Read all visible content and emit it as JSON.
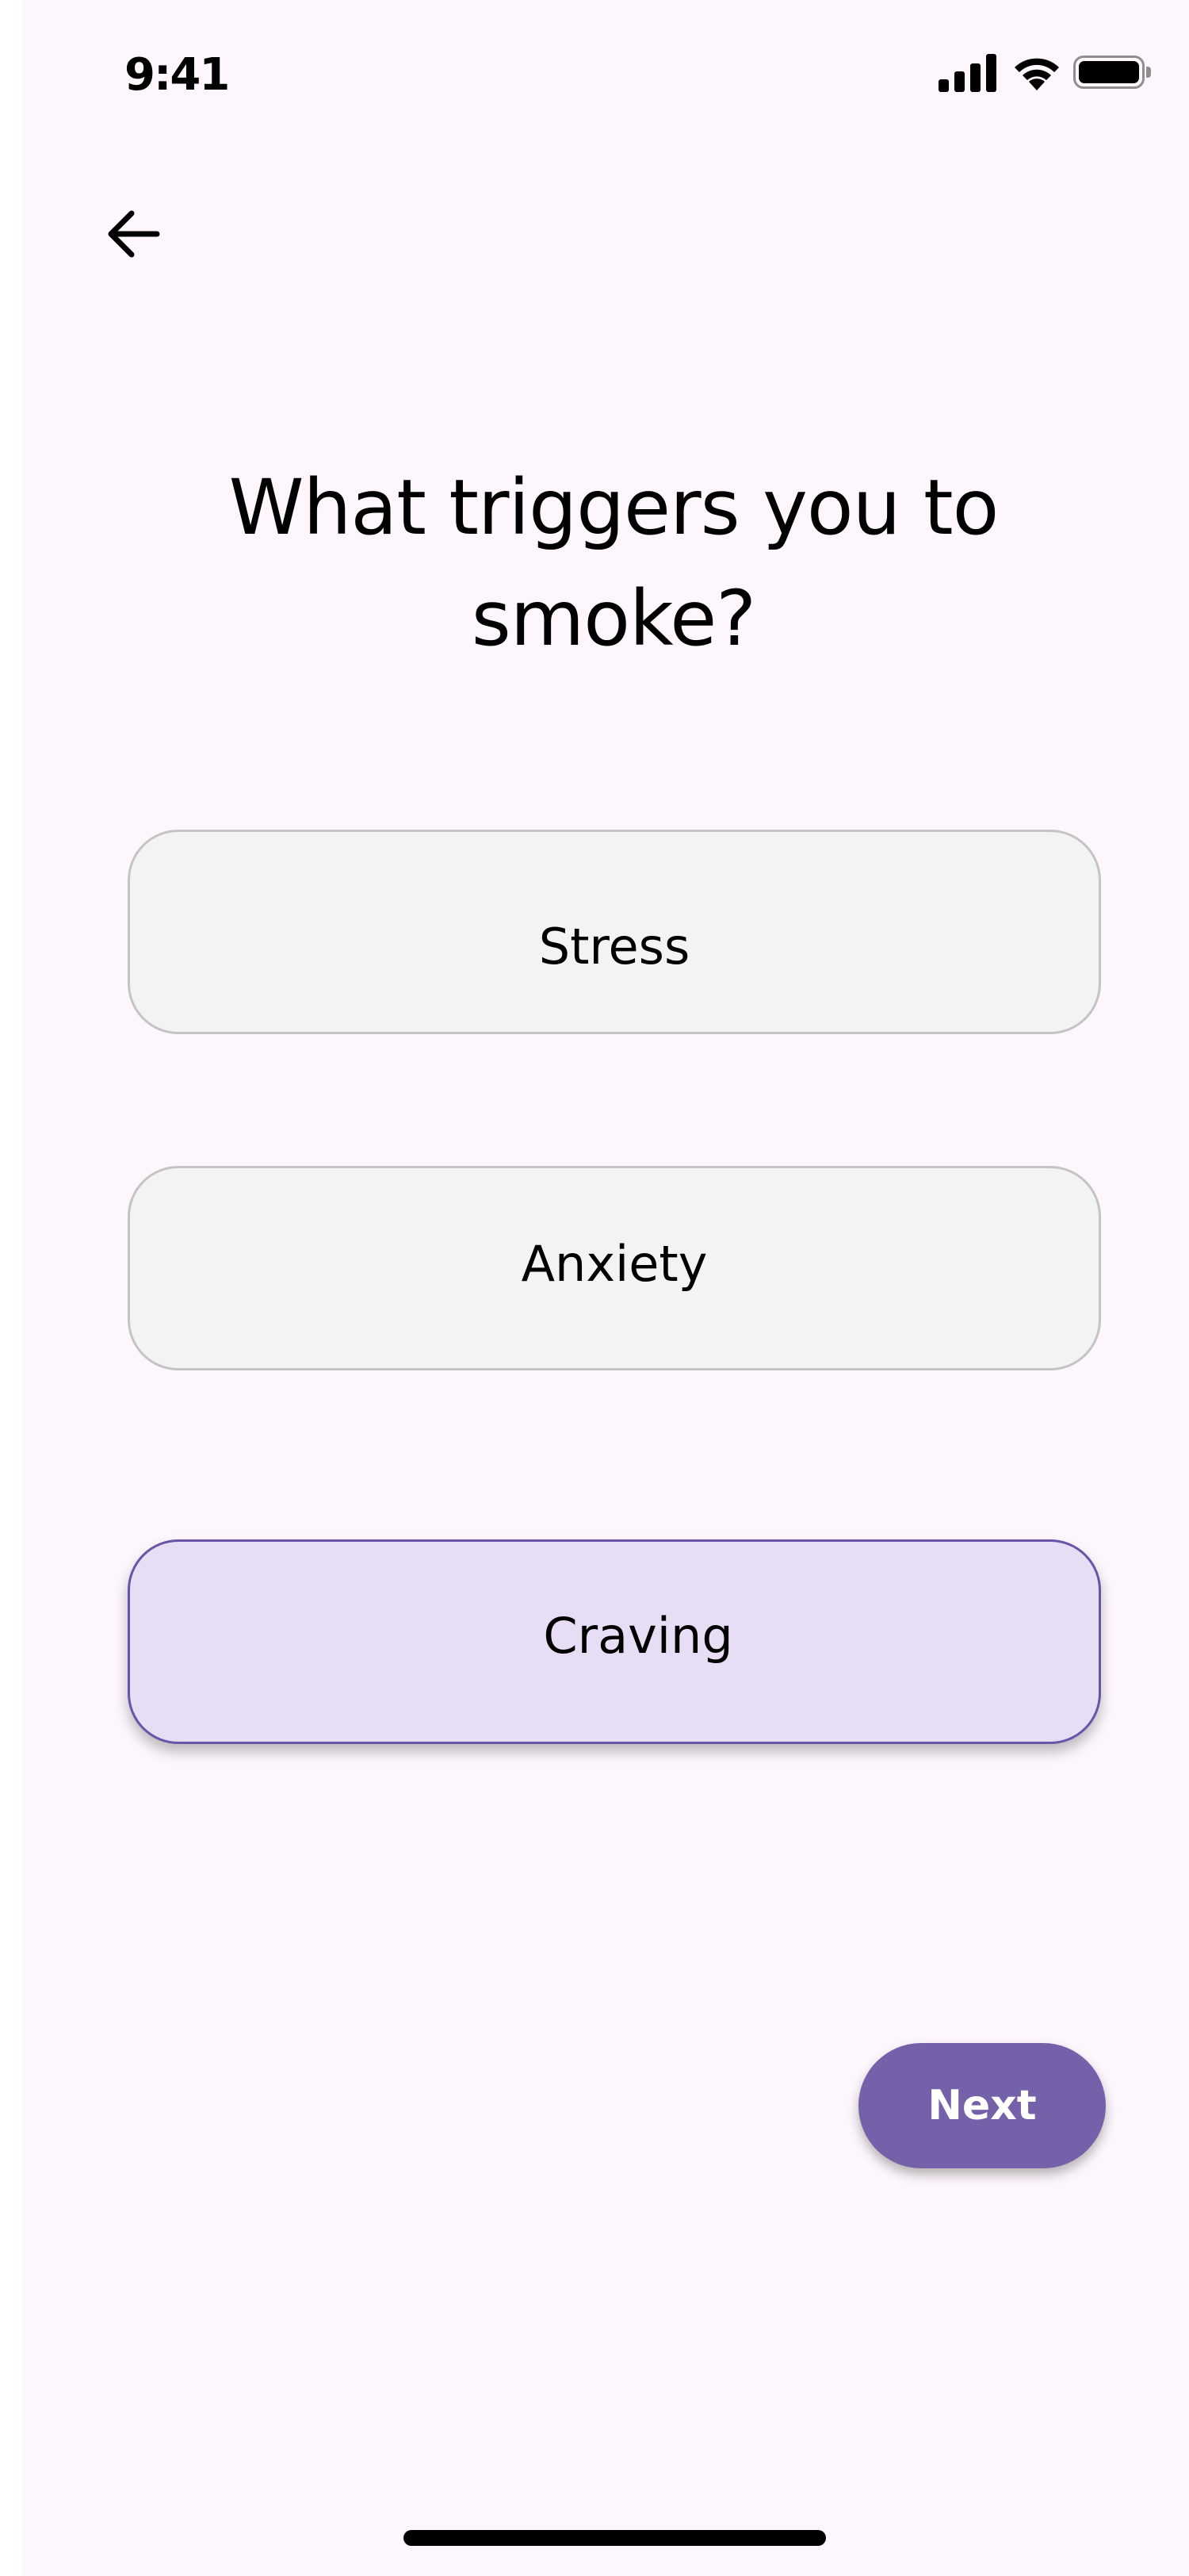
{
  "status_bar": {
    "time": "9:41",
    "icons": [
      "signal-icon",
      "wifi-icon",
      "battery-icon"
    ]
  },
  "navigation": {
    "back_icon": "arrow-left-icon"
  },
  "question": "What triggers you to smoke?",
  "options": [
    {
      "label": "Stress",
      "selected": false
    },
    {
      "label": "Anxiety",
      "selected": false
    },
    {
      "label": "Craving",
      "selected": true
    }
  ],
  "next_label": "Next",
  "colors": {
    "background": "#fdf6fc",
    "option_background": "#f3f3f3",
    "option_border": "#c4c4c4",
    "selected_background": "#e7def6",
    "selected_border": "#6a54a8",
    "accent": "#7560aa"
  }
}
